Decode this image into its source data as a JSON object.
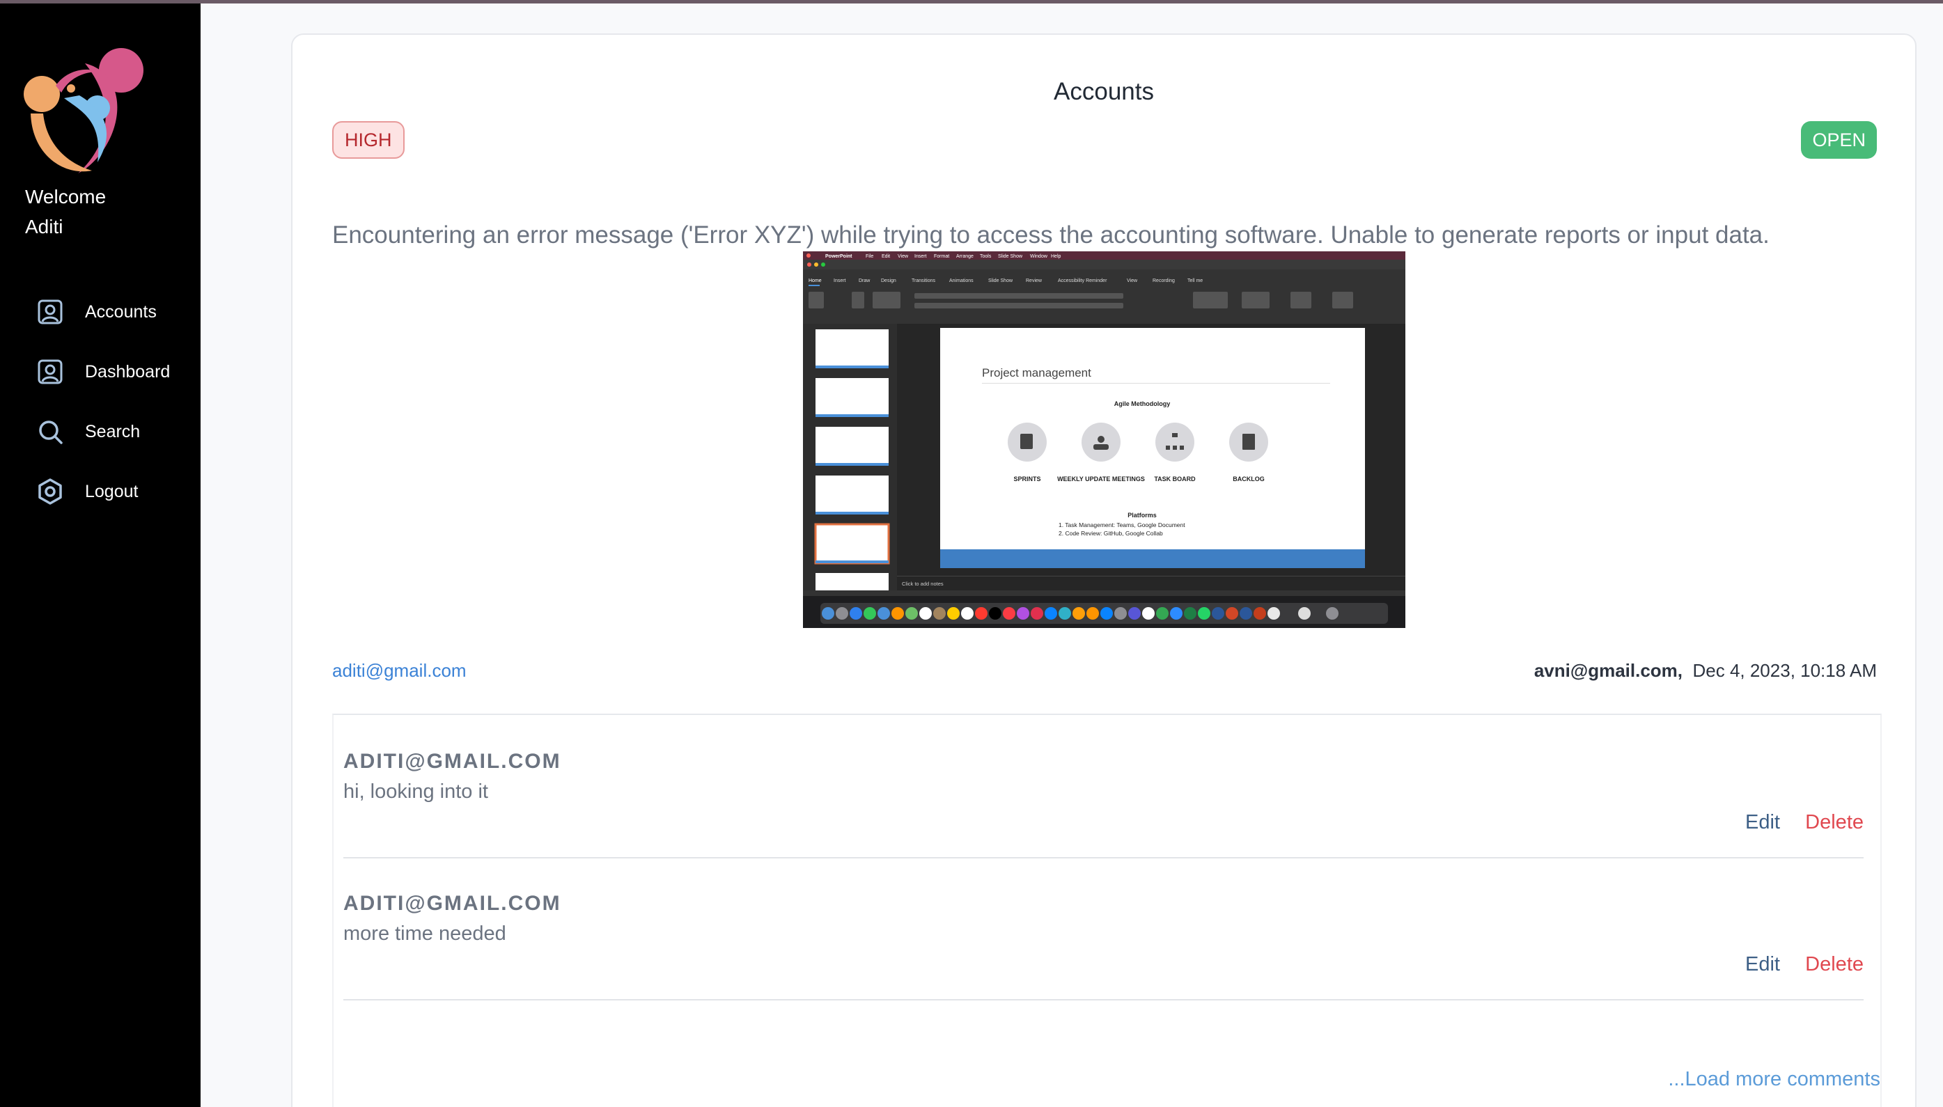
{
  "sidebar": {
    "welcome_line1": "Welcome",
    "welcome_line2": "Aditi",
    "items": [
      {
        "label": "Accounts",
        "icon": "user-square-icon"
      },
      {
        "label": "Dashboard",
        "icon": "user-square-icon"
      },
      {
        "label": "Search",
        "icon": "search-icon"
      },
      {
        "label": "Logout",
        "icon": "logout-hexagon-icon"
      }
    ]
  },
  "ticket": {
    "title": "Accounts",
    "priority": "HIGH",
    "status": "OPEN",
    "description": "Encountering an error message ('Error XYZ') while trying to access the accounting software. Unable to generate reports or input data.",
    "reporter": "aditi@gmail.com",
    "assignee": "avni@gmail.com,",
    "date": "Dec 4, 2023, 10:18 AM"
  },
  "attachment": {
    "app_menu": [
      "PowerPoint",
      "File",
      "Edit",
      "View",
      "Insert",
      "Format",
      "Arrange",
      "Tools",
      "Slide Show",
      "Window",
      "Help"
    ],
    "ribbon_tabs": [
      "Home",
      "Insert",
      "Draw",
      "Design",
      "Transitions",
      "Animations",
      "Slide Show",
      "Review",
      "Accessibility Reminder",
      "View",
      "Recording",
      "Tell me"
    ],
    "slide_title": "Project management",
    "slide_subtitle": "Agile Methodology",
    "slide_items": [
      "SPRINTS",
      "WEEKLY UPDATE MEETINGS",
      "TASK BOARD",
      "BACKLOG"
    ],
    "platforms_heading": "Platforms",
    "platforms": [
      "1.  Task Management: Teams, Google Document",
      "2.  Code Review: GitHub, Google Collab"
    ],
    "notes_placeholder": "Click to add notes"
  },
  "comments": [
    {
      "author": "ADITI@GMAIL.COM",
      "text": "hi, looking into it",
      "edit": "Edit",
      "delete": "Delete"
    },
    {
      "author": "ADITI@GMAIL.COM",
      "text": "more time needed",
      "edit": "Edit",
      "delete": "Delete"
    }
  ],
  "load_more": "...Load more comments",
  "colors": {
    "sidebar_bg": "#000000",
    "high_badge_bg": "#fde3e3",
    "high_badge_text": "#b5282e",
    "open_badge_bg": "#48bb78",
    "link": "#3b82d6",
    "delete": "#e0484f",
    "edit": "#3d5f86"
  }
}
